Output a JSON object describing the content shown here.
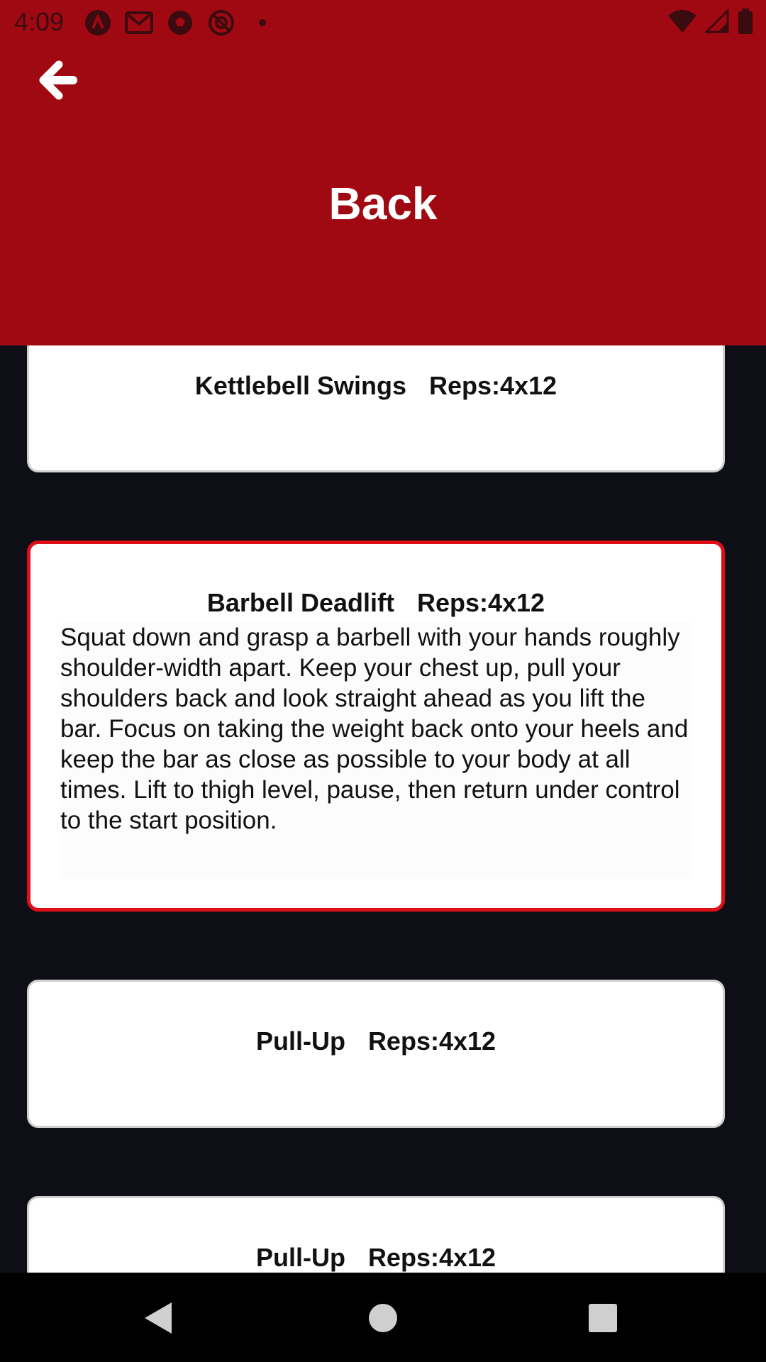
{
  "status_bar": {
    "time": "4:09",
    "left_icons": [
      "a-app-icon",
      "gmail-icon",
      "soccer-ball-icon",
      "at-sign-icon",
      "dot-icon"
    ],
    "right_icons": [
      "wifi-icon",
      "signal-icon",
      "battery-icon"
    ]
  },
  "header": {
    "title": "Back",
    "back_icon": "arrow-left-icon",
    "color": "#a00911"
  },
  "exercises": [
    {
      "name": "Kettlebell Swings",
      "reps": "Reps:4x12",
      "selected": false,
      "description": ""
    },
    {
      "name": "Barbell Deadlift",
      "reps": "Reps:4x12",
      "selected": true,
      "description": "Squat down and grasp a barbell with your hands roughly shoulder-width apart. Keep your chest up, pull your shoulders back and look straight ahead as you lift the bar. Focus on taking the weight back onto your heels and keep the bar as close as possible to your body at all times. Lift to thigh level, pause, then return under control to the start position."
    },
    {
      "name": "Pull-Up",
      "reps": "Reps:4x12",
      "selected": false,
      "description": ""
    },
    {
      "name": "Pull-Up",
      "reps": "Reps:4x12",
      "selected": false,
      "description": ""
    }
  ],
  "nav_bar": {
    "buttons": [
      "back-triangle-icon",
      "home-circle-icon",
      "recents-square-icon"
    ]
  },
  "colors": {
    "background": "#0e0e16",
    "card": "#ffffff",
    "selected_border": "#e00f17"
  }
}
